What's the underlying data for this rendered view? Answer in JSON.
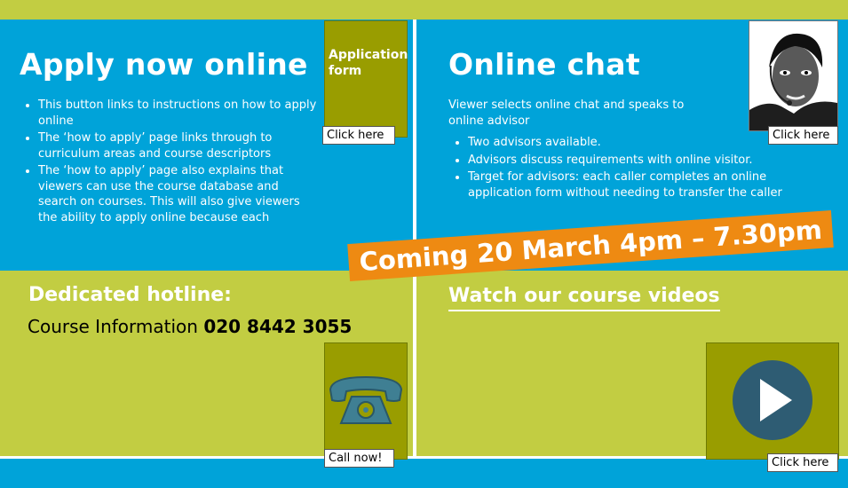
{
  "colors": {
    "blue": "#00a3d9",
    "green": "#c2cd42",
    "olive": "#999d00",
    "orange": "#ee8a12",
    "play_circle": "#2e5c73",
    "phone": "#3f7f93"
  },
  "apply": {
    "title": "Apply now online",
    "bullets": [
      "This button links to instructions on how to apply online",
      "The ‘how to apply’ page links through to curriculum areas and course descriptors",
      "The ‘how to apply’ page also explains that viewers can use the course database and search on courses. This will also give viewers the ability to apply online because each"
    ],
    "form_box_line1": "Application",
    "form_box_line2": "form",
    "button": "Click here"
  },
  "chat": {
    "title": "Online chat",
    "intro": "Viewer selects online chat and speaks to online advisor",
    "bullets": [
      "Two advisors available.",
      "Advisors discuss requirements with online visitor.",
      "Target for advisors: each caller completes an online application form without needing to transfer the caller"
    ],
    "avatar_icon": "advisor-headset-portrait",
    "button": "Click here"
  },
  "banner": "Coming 20 March 4pm – 7.30pm",
  "hotline": {
    "title": "Dedicated hotline:",
    "label": "Course Information",
    "number": "020 8442 3055",
    "icon": "telephone-icon",
    "button": "Call now!"
  },
  "videos": {
    "link": "Watch our course videos",
    "icon": "play-icon",
    "button": "Click here"
  }
}
